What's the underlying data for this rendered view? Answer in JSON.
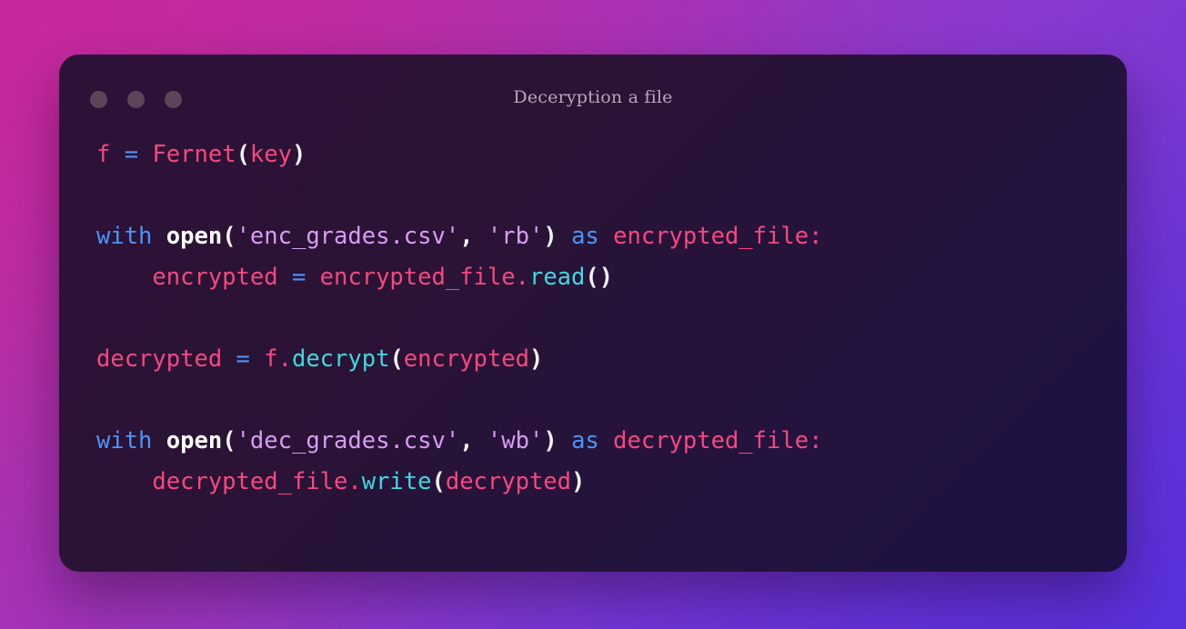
{
  "theme": {
    "page_gradient_top_left": "#c42c9f",
    "page_gradient_top_right": "#8a3ad0",
    "page_gradient_bottom_left": "#9a35b3",
    "page_gradient_bottom_right": "#6234d8",
    "card_background_start": "#2c1236",
    "card_background_end": "#1c1140",
    "dot_color": "#5d4459",
    "title_color": "#b9a7b8",
    "color_variable": "#f7487f",
    "color_operator": "#4d94fa",
    "color_keyword": "#4d94fa",
    "color_builtin": "#ffffff",
    "color_string": "#d79cf2",
    "color_method": "#3fd8e0",
    "color_punctuation": "#f2f2f2"
  },
  "window": {
    "title": "Deceryption a file",
    "traffic_lights": [
      {
        "name": "close",
        "label": ""
      },
      {
        "name": "minimize",
        "label": ""
      },
      {
        "name": "maximize",
        "label": ""
      }
    ]
  },
  "code": {
    "language": "python",
    "plain_text": "f = Fernet(key)\n\nwith open('enc_grades.csv', 'rb') as encrypted_file:\n    encrypted = encrypted_file.read()\n\ndecrypted = f.decrypt(encrypted)\n\nwith open('dec_grades.csv', 'wb') as decrypted_file:\n    decrypted_file.write(decrypted)",
    "lines": [
      {
        "index": 1,
        "text": "f = Fernet(key)",
        "tokens": [
          {
            "t": "f",
            "c": "var"
          },
          {
            "t": " ",
            "c": "plain"
          },
          {
            "t": "=",
            "c": "op"
          },
          {
            "t": " ",
            "c": "plain"
          },
          {
            "t": "Fernet",
            "c": "call"
          },
          {
            "t": "(",
            "c": "punct"
          },
          {
            "t": "key",
            "c": "var"
          },
          {
            "t": ")",
            "c": "punct"
          }
        ]
      },
      {
        "index": 2,
        "text": "",
        "tokens": []
      },
      {
        "index": 3,
        "text": "with open('enc_grades.csv', 'rb') as encrypted_file:",
        "tokens": [
          {
            "t": "with",
            "c": "keyword"
          },
          {
            "t": " ",
            "c": "plain"
          },
          {
            "t": "open",
            "c": "builtin"
          },
          {
            "t": "(",
            "c": "punct"
          },
          {
            "t": "'enc_grades.csv'",
            "c": "string"
          },
          {
            "t": ",",
            "c": "punct"
          },
          {
            "t": " ",
            "c": "plain"
          },
          {
            "t": "'rb'",
            "c": "string"
          },
          {
            "t": ")",
            "c": "punct"
          },
          {
            "t": " ",
            "c": "plain"
          },
          {
            "t": "as",
            "c": "keyword"
          },
          {
            "t": " ",
            "c": "plain"
          },
          {
            "t": "encrypted_file",
            "c": "var"
          },
          {
            "t": ":",
            "c": "colon"
          }
        ]
      },
      {
        "index": 4,
        "text": "    encrypted = encrypted_file.read()",
        "tokens": [
          {
            "t": "    ",
            "c": "plain"
          },
          {
            "t": "encrypted",
            "c": "var"
          },
          {
            "t": " ",
            "c": "plain"
          },
          {
            "t": "=",
            "c": "op"
          },
          {
            "t": " ",
            "c": "plain"
          },
          {
            "t": "encrypted_file",
            "c": "var"
          },
          {
            "t": ".",
            "c": "dot"
          },
          {
            "t": "read",
            "c": "method"
          },
          {
            "t": "()",
            "c": "punct"
          }
        ]
      },
      {
        "index": 5,
        "text": "",
        "tokens": []
      },
      {
        "index": 6,
        "text": "decrypted = f.decrypt(encrypted)",
        "tokens": [
          {
            "t": "decrypted",
            "c": "var"
          },
          {
            "t": " ",
            "c": "plain"
          },
          {
            "t": "=",
            "c": "op"
          },
          {
            "t": " ",
            "c": "plain"
          },
          {
            "t": "f",
            "c": "var"
          },
          {
            "t": ".",
            "c": "dot"
          },
          {
            "t": "decrypt",
            "c": "method"
          },
          {
            "t": "(",
            "c": "punct"
          },
          {
            "t": "encrypted",
            "c": "var"
          },
          {
            "t": ")",
            "c": "punct"
          }
        ]
      },
      {
        "index": 7,
        "text": "",
        "tokens": []
      },
      {
        "index": 8,
        "text": "with open('dec_grades.csv', 'wb') as decrypted_file:",
        "tokens": [
          {
            "t": "with",
            "c": "keyword"
          },
          {
            "t": " ",
            "c": "plain"
          },
          {
            "t": "open",
            "c": "builtin"
          },
          {
            "t": "(",
            "c": "punct"
          },
          {
            "t": "'dec_grades.csv'",
            "c": "string"
          },
          {
            "t": ",",
            "c": "punct"
          },
          {
            "t": " ",
            "c": "plain"
          },
          {
            "t": "'wb'",
            "c": "string"
          },
          {
            "t": ")",
            "c": "punct"
          },
          {
            "t": " ",
            "c": "plain"
          },
          {
            "t": "as",
            "c": "keyword"
          },
          {
            "t": " ",
            "c": "plain"
          },
          {
            "t": "decrypted_file",
            "c": "var"
          },
          {
            "t": ":",
            "c": "colon"
          }
        ]
      },
      {
        "index": 9,
        "text": "    decrypted_file.write(decrypted)",
        "tokens": [
          {
            "t": "    ",
            "c": "plain"
          },
          {
            "t": "decrypted_file",
            "c": "var"
          },
          {
            "t": ".",
            "c": "dot"
          },
          {
            "t": "write",
            "c": "method"
          },
          {
            "t": "(",
            "c": "punct"
          },
          {
            "t": "decrypted",
            "c": "var"
          },
          {
            "t": ")",
            "c": "punct"
          }
        ]
      }
    ]
  }
}
